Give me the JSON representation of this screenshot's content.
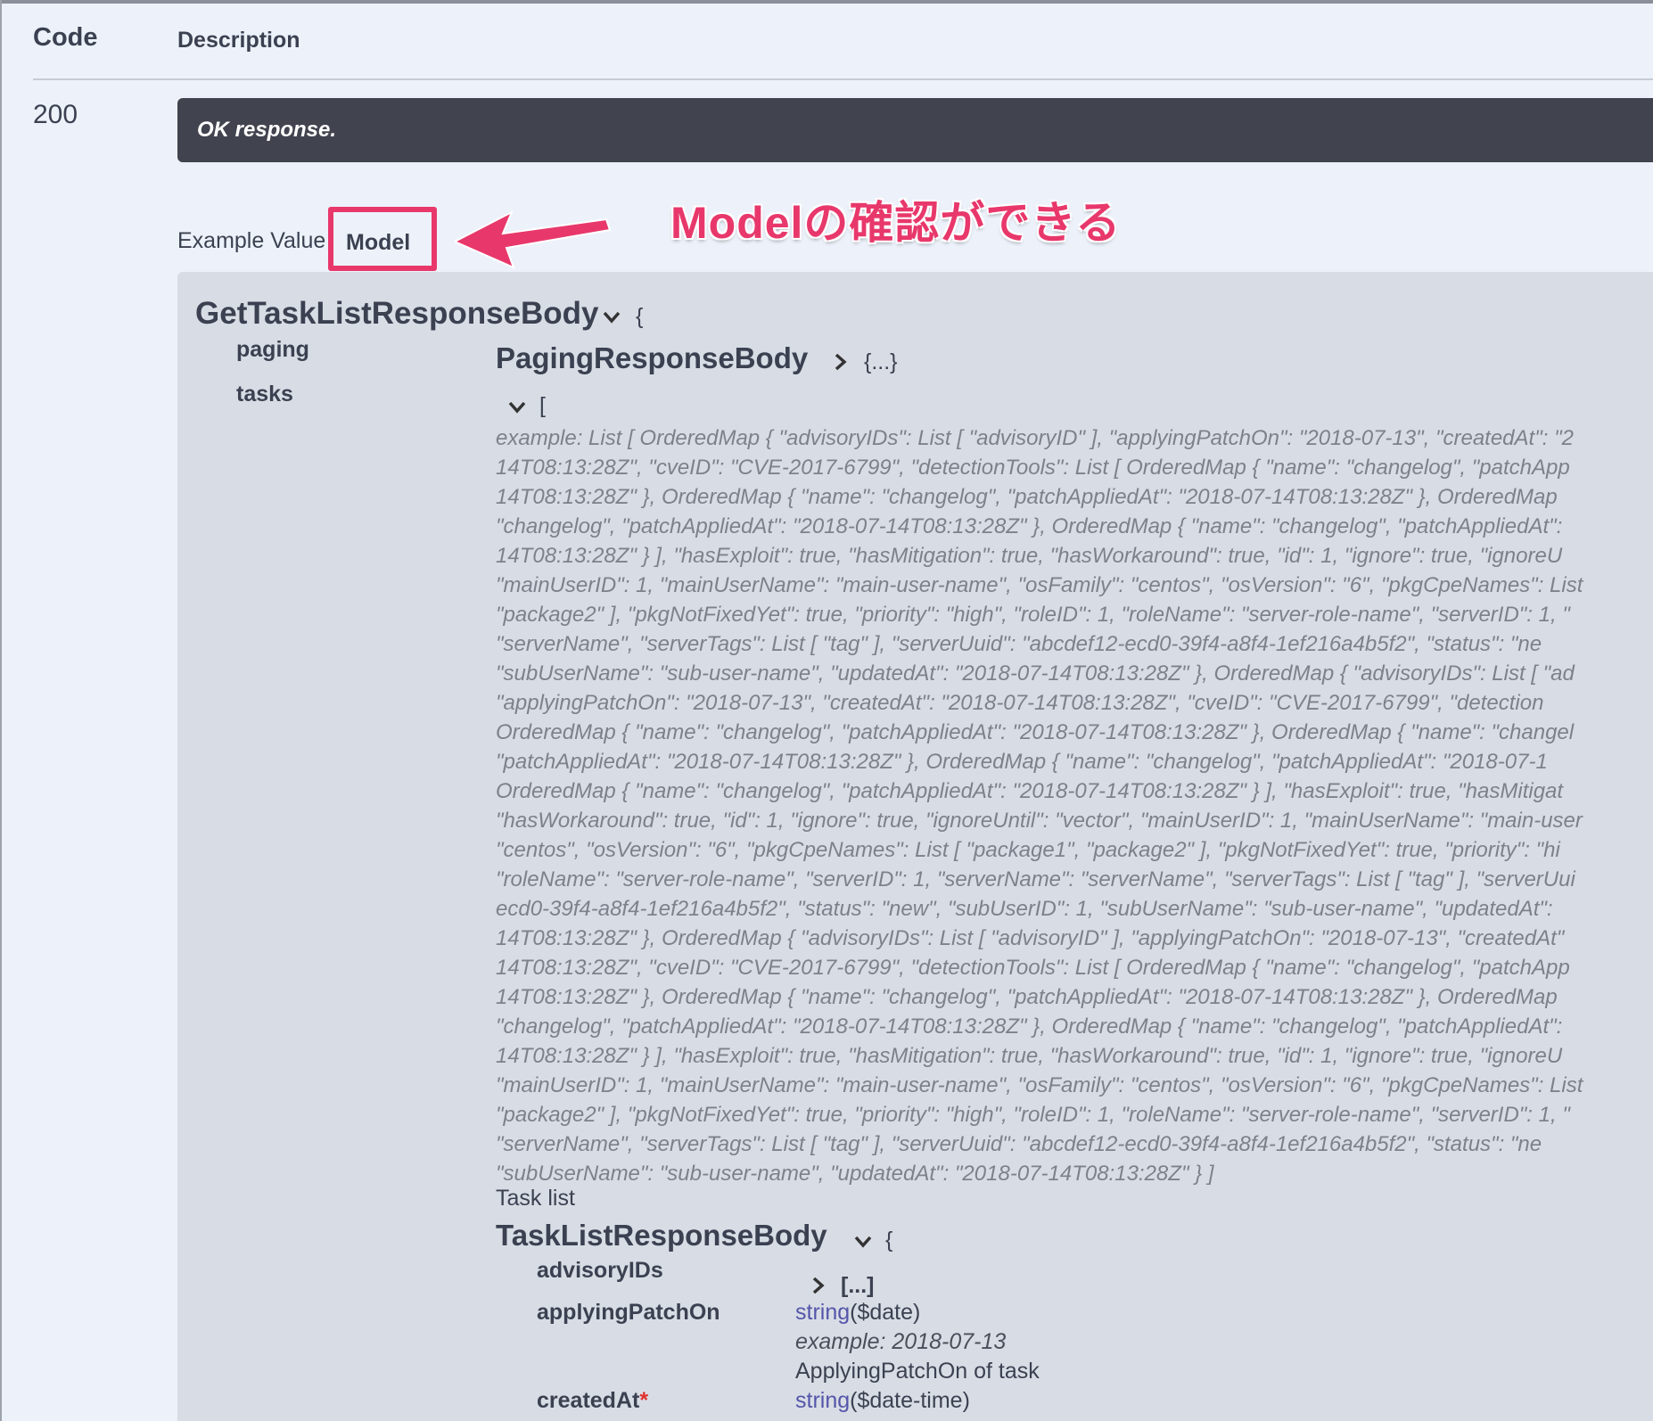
{
  "table": {
    "header_code": "Code",
    "header_description": "Description"
  },
  "response": {
    "code": "200",
    "description": "OK response."
  },
  "tabs": {
    "example_value": "Example Value",
    "model": "Model"
  },
  "annotation": {
    "text": "Modelの確認ができる",
    "color": "#e8386b"
  },
  "model": {
    "title": "GetTaskListResponseBody",
    "title_brace": "{",
    "paging_label": "paging",
    "paging_type": "PagingResponseBody",
    "paging_collapsed": "{...}",
    "tasks_label": "tasks",
    "tasks_bracket": "[",
    "example_lines": [
      "example: List [ OrderedMap { \"advisoryIDs\": List [ \"advisoryID\" ], \"applyingPatchOn\": \"2018-07-13\", \"createdAt\": \"2",
      "14T08:13:28Z\", \"cveID\": \"CVE-2017-6799\", \"detectionTools\": List [ OrderedMap { \"name\": \"changelog\", \"patchApp",
      "14T08:13:28Z\" }, OrderedMap { \"name\": \"changelog\", \"patchAppliedAt\": \"2018-07-14T08:13:28Z\" }, OrderedMap",
      "\"changelog\", \"patchAppliedAt\": \"2018-07-14T08:13:28Z\" }, OrderedMap { \"name\": \"changelog\", \"patchAppliedAt\":",
      "14T08:13:28Z\" } ], \"hasExploit\": true, \"hasMitigation\": true, \"hasWorkaround\": true, \"id\": 1, \"ignore\": true, \"ignoreU",
      "\"mainUserID\": 1, \"mainUserName\": \"main-user-name\", \"osFamily\": \"centos\", \"osVersion\": \"6\", \"pkgCpeNames\": List",
      "\"package2\" ], \"pkgNotFixedYet\": true, \"priority\": \"high\", \"roleID\": 1, \"roleName\": \"server-role-name\", \"serverID\": 1, \"",
      "\"serverName\", \"serverTags\": List [ \"tag\" ], \"serverUuid\": \"abcdef12-ecd0-39f4-a8f4-1ef216a4b5f2\", \"status\": \"ne",
      "\"subUserName\": \"sub-user-name\", \"updatedAt\": \"2018-07-14T08:13:28Z\" }, OrderedMap { \"advisoryIDs\": List [ \"ad",
      "\"applyingPatchOn\": \"2018-07-13\", \"createdAt\": \"2018-07-14T08:13:28Z\", \"cveID\": \"CVE-2017-6799\", \"detection",
      "OrderedMap { \"name\": \"changelog\", \"patchAppliedAt\": \"2018-07-14T08:13:28Z\" }, OrderedMap { \"name\": \"changel",
      "\"patchAppliedAt\": \"2018-07-14T08:13:28Z\" }, OrderedMap { \"name\": \"changelog\", \"patchAppliedAt\": \"2018-07-1",
      "OrderedMap { \"name\": \"changelog\", \"patchAppliedAt\": \"2018-07-14T08:13:28Z\" } ], \"hasExploit\": true, \"hasMitigat",
      "\"hasWorkaround\": true, \"id\": 1, \"ignore\": true, \"ignoreUntil\": \"vector\", \"mainUserID\": 1, \"mainUserName\": \"main-user",
      "\"centos\", \"osVersion\": \"6\", \"pkgCpeNames\": List [ \"package1\", \"package2\" ], \"pkgNotFixedYet\": true, \"priority\": \"hi",
      "\"roleName\": \"server-role-name\", \"serverID\": 1, \"serverName\": \"serverName\", \"serverTags\": List [ \"tag\" ], \"serverUui",
      "ecd0-39f4-a8f4-1ef216a4b5f2\", \"status\": \"new\", \"subUserID\": 1, \"subUserName\": \"sub-user-name\", \"updatedAt\":",
      "14T08:13:28Z\" }, OrderedMap { \"advisoryIDs\": List [ \"advisoryID\" ], \"applyingPatchOn\": \"2018-07-13\", \"createdAt\"",
      "14T08:13:28Z\", \"cveID\": \"CVE-2017-6799\", \"detectionTools\": List [ OrderedMap { \"name\": \"changelog\", \"patchApp",
      "14T08:13:28Z\" }, OrderedMap { \"name\": \"changelog\", \"patchAppliedAt\": \"2018-07-14T08:13:28Z\" }, OrderedMap",
      "\"changelog\", \"patchAppliedAt\": \"2018-07-14T08:13:28Z\" }, OrderedMap { \"name\": \"changelog\", \"patchAppliedAt\":",
      "14T08:13:28Z\" } ], \"hasExploit\": true, \"hasMitigation\": true, \"hasWorkaround\": true, \"id\": 1, \"ignore\": true, \"ignoreU",
      "\"mainUserID\": 1, \"mainUserName\": \"main-user-name\", \"osFamily\": \"centos\", \"osVersion\": \"6\", \"pkgCpeNames\": List",
      "\"package2\" ], \"pkgNotFixedYet\": true, \"priority\": \"high\", \"roleID\": 1, \"roleName\": \"server-role-name\", \"serverID\": 1, \"",
      "\"serverName\", \"serverTags\": List [ \"tag\" ], \"serverUuid\": \"abcdef12-ecd0-39f4-a8f4-1ef216a4b5f2\", \"status\": \"ne",
      "\"subUserName\": \"sub-user-name\", \"updatedAt\": \"2018-07-14T08:13:28Z\" } ]"
    ],
    "tasks_description": "Task list",
    "item_type": "TaskListResponseBody",
    "item_brace": "{",
    "fields": {
      "advisory_ids_label": "advisoryIDs",
      "advisory_ids_collapsed": "[...]",
      "applying_patch_on_label": "applyingPatchOn",
      "applying_patch_on_type": "string",
      "applying_patch_on_format": "($date)",
      "applying_patch_on_example": "example: 2018-07-13",
      "applying_patch_on_description": "ApplyingPatchOn of task",
      "created_at_label": "createdAt",
      "created_at_required": "*",
      "created_at_type": "string",
      "created_at_format": "($date-time)"
    }
  }
}
